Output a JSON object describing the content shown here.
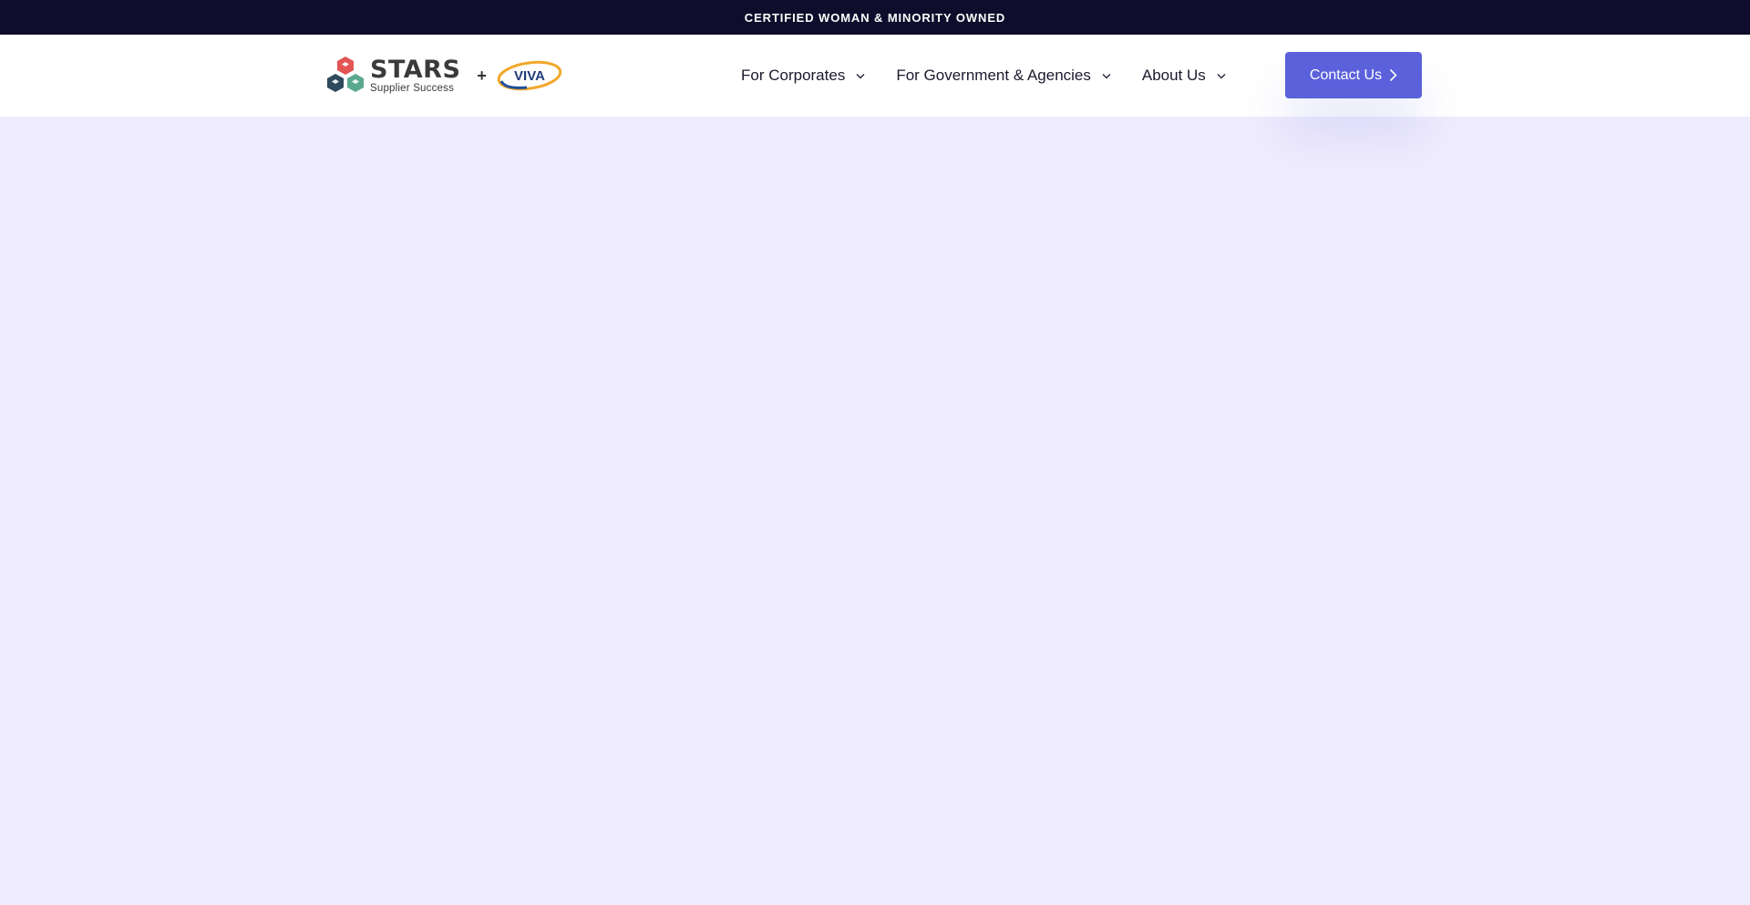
{
  "topbar": {
    "text": "CERTIFIED WOMAN & MINORITY OWNED"
  },
  "logo": {
    "title": "STARS",
    "subtitle": "Supplier Success",
    "plus": "+",
    "partner": "VIVA"
  },
  "nav": {
    "items": [
      {
        "label": "For Corporates"
      },
      {
        "label": "For Government & Agencies"
      },
      {
        "label": "About Us"
      }
    ],
    "contact_label": "Contact Us"
  },
  "colors": {
    "topbar_bg": "#0e0d2b",
    "accent": "#5b61db",
    "hero_bg": "#efecfd"
  }
}
